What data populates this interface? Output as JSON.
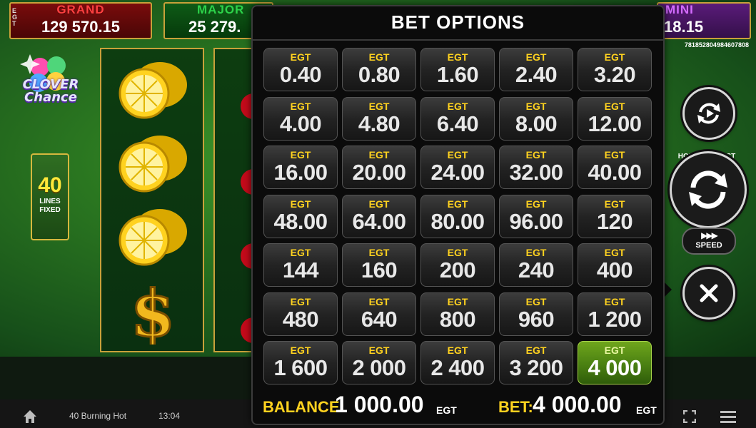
{
  "jackpots": {
    "grand": {
      "label": "GRAND",
      "value": "129 570.15",
      "currency_tag": "EGT"
    },
    "major": {
      "label": "MAJOR",
      "value": "25 279."
    },
    "mini": {
      "label": "MINI",
      "value": "18.15"
    }
  },
  "ticket_id": "781852804984607808",
  "logo": {
    "line1": "CLOVER",
    "line2": "Chance"
  },
  "lines": {
    "count": "40",
    "label_line1": "LINES",
    "label_line2": "FIXED"
  },
  "bet_options": {
    "title": "BET OPTIONS",
    "currency": "EGT",
    "options": [
      "0.40",
      "0.80",
      "1.60",
      "2.40",
      "3.20",
      "4.00",
      "4.80",
      "6.40",
      "8.00",
      "12.00",
      "16.00",
      "20.00",
      "24.00",
      "32.00",
      "40.00",
      "48.00",
      "64.00",
      "80.00",
      "96.00",
      "120",
      "144",
      "160",
      "200",
      "240",
      "400",
      "480",
      "640",
      "800",
      "960",
      "1 200",
      "1 600",
      "2 000",
      "2 400",
      "3 200",
      "4 000"
    ],
    "selected": "4 000",
    "balance_label": "BALANCE:",
    "balance_value": "1 000.00",
    "balance_currency": "EGT",
    "bet_label": "BET:",
    "bet_value": "4 000.00",
    "bet_currency": "EGT"
  },
  "controls": {
    "spin_hint": "HOLD FOR FAST PLAY",
    "speed_icon": "▶▶▶",
    "speed_label": "SPEED"
  },
  "bottom_bar": {
    "game_name": "40 Burning Hot",
    "clock": "13:04"
  },
  "colors": {
    "accent_yellow": "#ffd21f",
    "selected_green": "#4a8012",
    "grand_red": "#ff4040",
    "major_green": "#2dd34a",
    "mini_purple": "#d46cff"
  }
}
